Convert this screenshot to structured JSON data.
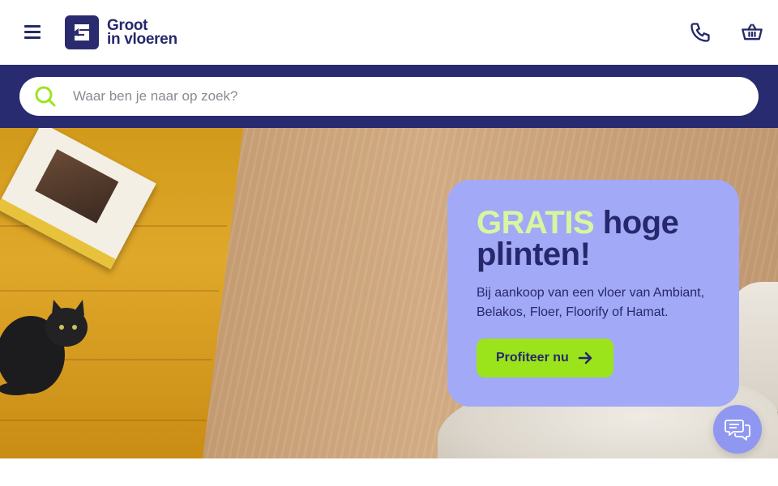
{
  "header": {
    "menu_icon": "hamburger-icon",
    "logo": {
      "line1": "Groot",
      "line2": "in vloeren"
    },
    "phone_icon": "phone-icon",
    "cart_icon": "basket-icon"
  },
  "search": {
    "placeholder": "Waar ben je naar op zoek?",
    "value": "",
    "icon": "search-icon"
  },
  "promo": {
    "title_highlight": "GRATIS",
    "title_rest_1": "hoge",
    "title_rest_2": "plinten!",
    "body": "Bij aankoop van een vloer van Ambiant, Belakos, Floer, Floorify of Hamat.",
    "cta_label": "Profiteer nu",
    "cta_icon": "arrow-right-icon"
  },
  "chat": {
    "icon": "chat-bubbles-icon"
  },
  "colors": {
    "navy": "#27286b",
    "search_band": "#292b70",
    "promo_bg": "#a2a9f6",
    "highlight": "#d9f5a0",
    "cta_green": "#9be41b",
    "search_icon": "#9be41b",
    "chat_bg": "#8f97f0"
  }
}
